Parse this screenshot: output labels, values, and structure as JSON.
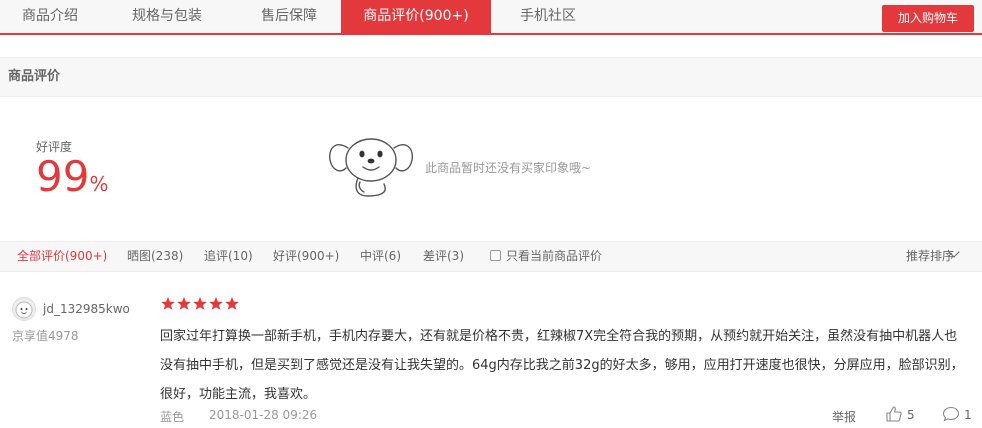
{
  "tabs": [
    {
      "label": "商品介绍",
      "active": false
    },
    {
      "label": "规格与包装",
      "active": false
    },
    {
      "label": "售后保障",
      "active": false
    },
    {
      "label": "商品评价(900+)",
      "active": true
    },
    {
      "label": "手机社区",
      "active": false
    }
  ],
  "cart_button": "加入购物车",
  "section_title": "商品评价",
  "rating": {
    "label": "好评度",
    "value": "99",
    "unit": "%"
  },
  "no_impression": "此商品暂时还没有买家印象哦~",
  "filters": [
    {
      "label": "全部评价(900+)",
      "active": true
    },
    {
      "label": "晒图(238)",
      "active": false
    },
    {
      "label": "追评(10)",
      "active": false
    },
    {
      "label": "好评(900+)",
      "active": false
    },
    {
      "label": "中评(6)",
      "active": false
    },
    {
      "label": "差评(3)",
      "active": false
    }
  ],
  "current_only_label": "只看当前商品评价",
  "sort_label": "推荐排序",
  "review": {
    "username": "jd_132985kwo",
    "jingxiang": "京享值4978",
    "stars": 5,
    "text": "回家过年打算换一部新手机，手机内存要大，还有就是价格不贵，红辣椒7X完全符合我的预期，从预约就开始关注，虽然没有抽中机器人也没有抽中手机，但是买到了感觉还是没有让我失望的。64g内存比我之前32g的好太多，够用，应用打开速度也很快，分屏应用，脸部识别，很好，功能主流，我喜欢。",
    "color": "蓝色",
    "date": "2018-01-28 09:26",
    "report": "举报",
    "likes": "5",
    "replies": "1"
  },
  "colors": {
    "accent": "#e4393c"
  },
  "icons": [
    "mascot-icon",
    "star-icon",
    "thumbs-up-icon",
    "comment-icon",
    "chevron-down-icon",
    "avatar-icon"
  ]
}
